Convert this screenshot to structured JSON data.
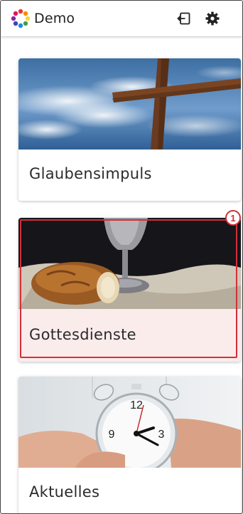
{
  "app": {
    "title": "Demo"
  },
  "toolbar": {
    "logout_icon": "logout-icon",
    "settings_icon": "gear-icon"
  },
  "cards": [
    {
      "label": "Glaubensimpuls",
      "image": "cross-sky-image"
    },
    {
      "label": "Gottesdienste",
      "image": "bread-chalice-image"
    },
    {
      "label": "Aktuelles",
      "image": "alarm-clock-image"
    }
  ],
  "annotation": {
    "marker": "1",
    "color": "#d32f3a"
  }
}
